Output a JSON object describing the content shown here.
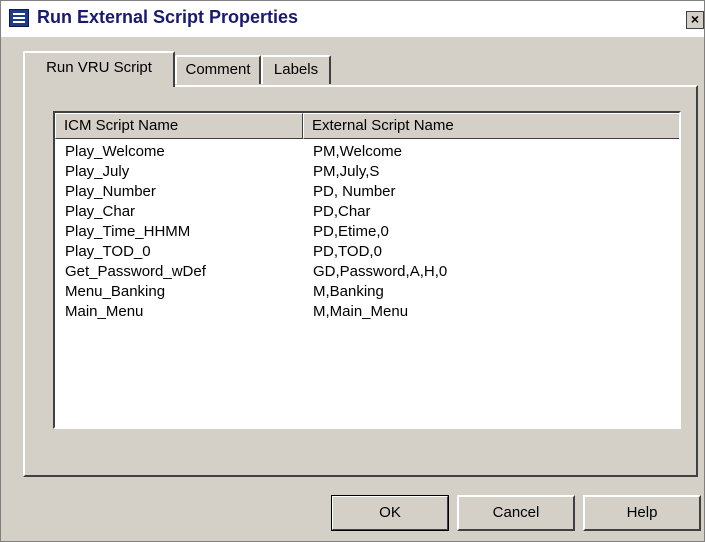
{
  "window": {
    "title": "Run External Script Properties",
    "close_label": "×"
  },
  "tabs": [
    {
      "label": "Run VRU Script",
      "active": true
    },
    {
      "label": "Comment",
      "active": false
    },
    {
      "label": "Labels",
      "active": false
    }
  ],
  "list": {
    "columns": [
      "ICM Script Name",
      "External Script Name"
    ],
    "rows": [
      {
        "icm": "Play_Welcome",
        "external": "PM,Welcome"
      },
      {
        "icm": "Play_July",
        "external": "PM,July,S"
      },
      {
        "icm": "Play_Number",
        "external": "PD, Number"
      },
      {
        "icm": "Play_Char",
        "external": "PD,Char"
      },
      {
        "icm": "Play_Time_HHMM",
        "external": "PD,Etime,0"
      },
      {
        "icm": "Play_TOD_0",
        "external": "PD,TOD,0"
      },
      {
        "icm": "Get_Password_wDef",
        "external": "GD,Password,A,H,0"
      },
      {
        "icm": "Menu_Banking",
        "external": "M,Banking"
      },
      {
        "icm": "Main_Menu",
        "external": "M,Main_Menu"
      }
    ]
  },
  "buttons": {
    "ok": "OK",
    "cancel": "Cancel",
    "help": "Help"
  }
}
